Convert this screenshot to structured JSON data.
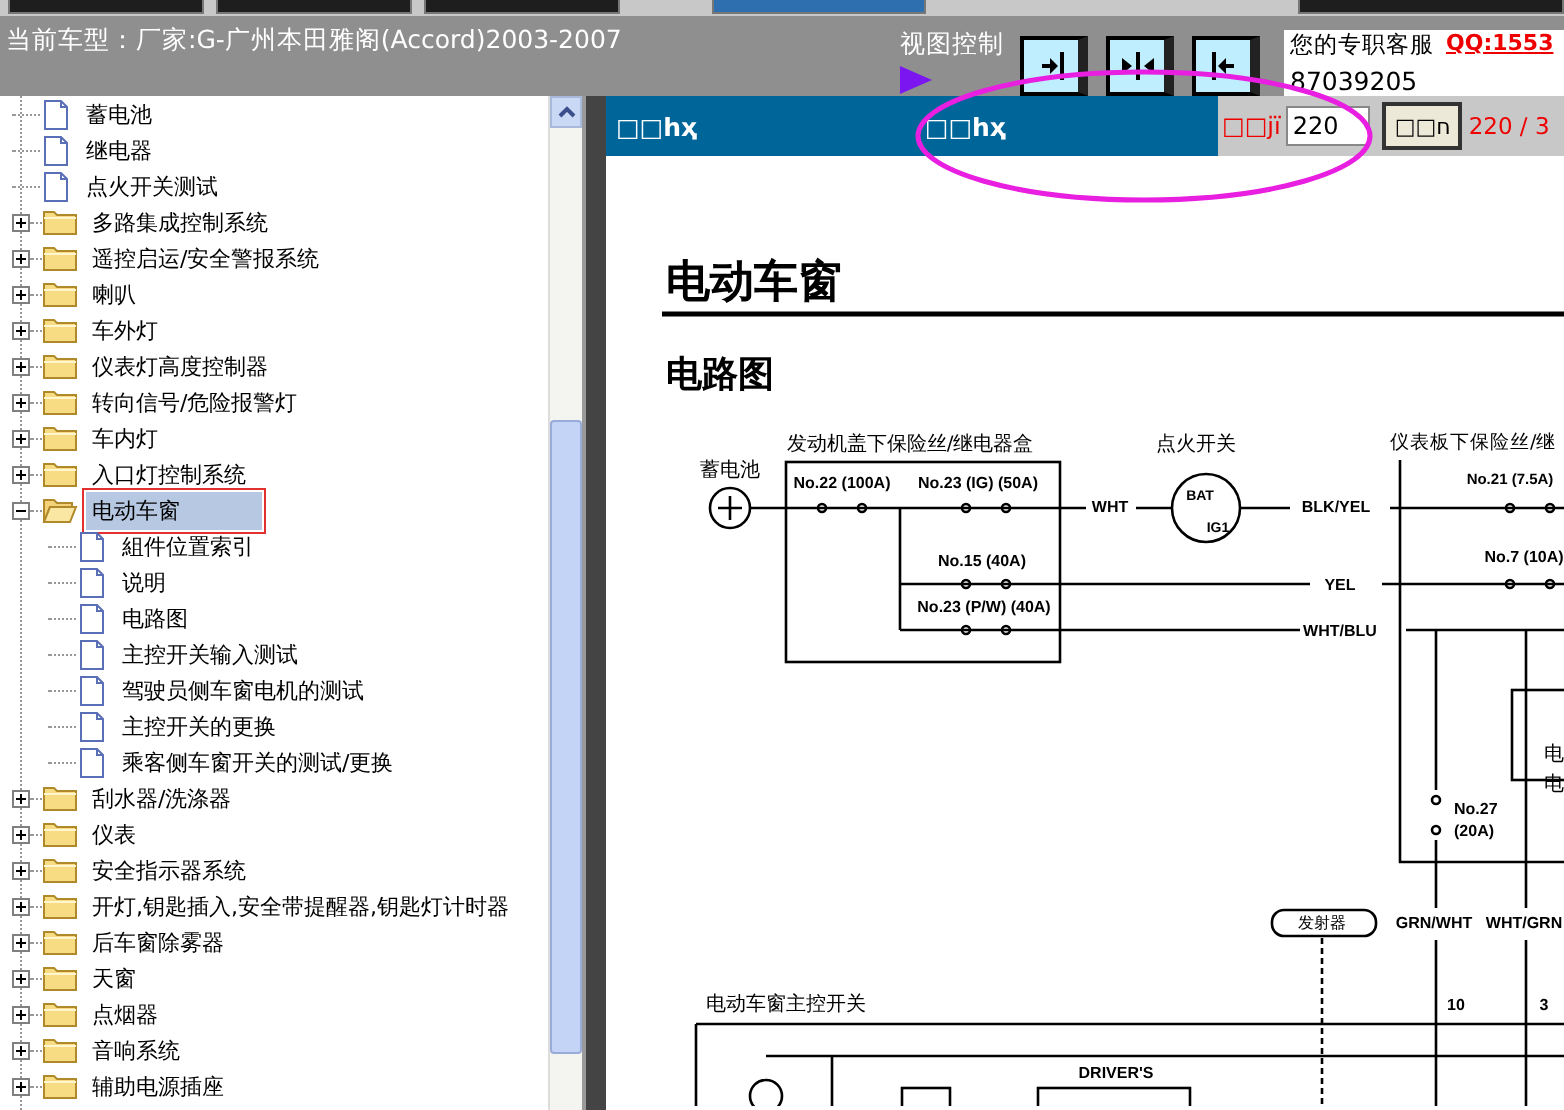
{
  "top_bar": {
    "car_model": "当前车型：厂家:G-广州本田雅阁(Accord)2003-2007",
    "view_control_label": "视图控制",
    "service_label": "您的专职客服",
    "qq_link": "QQ:1553",
    "phone": "87039205"
  },
  "tree": {
    "items": [
      {
        "label": "蓄电池",
        "kind": "doc",
        "selected": false
      },
      {
        "label": "继电器",
        "kind": "doc",
        "selected": false
      },
      {
        "label": "点火开关测试",
        "kind": "doc",
        "selected": false
      },
      {
        "label": "多路集成控制系统",
        "kind": "folder",
        "expanded": false,
        "selected": false
      },
      {
        "label": "遥控启运/安全警报系统",
        "kind": "folder",
        "expanded": false,
        "selected": false
      },
      {
        "label": "喇叭",
        "kind": "folder",
        "expanded": false,
        "selected": false
      },
      {
        "label": "车外灯",
        "kind": "folder",
        "expanded": false,
        "selected": false
      },
      {
        "label": "仪表灯高度控制器",
        "kind": "folder",
        "expanded": false,
        "selected": false
      },
      {
        "label": "转向信号/危险报警灯",
        "kind": "folder",
        "expanded": false,
        "selected": false
      },
      {
        "label": "车内灯",
        "kind": "folder",
        "expanded": false,
        "selected": false
      },
      {
        "label": "入口灯控制系统",
        "kind": "folder",
        "expanded": false,
        "selected": false
      },
      {
        "label": "电动车窗",
        "kind": "folder",
        "expanded": true,
        "selected": true,
        "children": [
          {
            "label": "組件位置索引",
            "kind": "doc",
            "selected": false
          },
          {
            "label": "说明",
            "kind": "doc",
            "selected": false
          },
          {
            "label": "电路图",
            "kind": "doc",
            "selected": false
          },
          {
            "label": "主控开关输入测试",
            "kind": "doc",
            "selected": false
          },
          {
            "label": "驾驶员侧车窗电机的测试",
            "kind": "doc",
            "selected": false
          },
          {
            "label": "主控开关的更换",
            "kind": "doc",
            "selected": false
          },
          {
            "label": "乘客侧车窗开关的测试/更换",
            "kind": "doc",
            "selected": false
          }
        ]
      },
      {
        "label": "刮水器/洗涤器",
        "kind": "folder",
        "expanded": false,
        "selected": false
      },
      {
        "label": "仪表",
        "kind": "folder",
        "expanded": false,
        "selected": false
      },
      {
        "label": "安全指示器系统",
        "kind": "folder",
        "expanded": false,
        "selected": false
      },
      {
        "label": "开灯,钥匙插入,安全带提醒器,钥匙灯计时器",
        "kind": "folder",
        "expanded": false,
        "selected": false
      },
      {
        "label": "后车窗除雾器",
        "kind": "folder",
        "expanded": false,
        "selected": false
      },
      {
        "label": "天窗",
        "kind": "folder",
        "expanded": false,
        "selected": false
      },
      {
        "label": "点烟器",
        "kind": "folder",
        "expanded": false,
        "selected": false
      },
      {
        "label": "音响系统",
        "kind": "folder",
        "expanded": false,
        "selected": false
      },
      {
        "label": "辅助电源插座",
        "kind": "folder",
        "expanded": false,
        "selected": false
      }
    ]
  },
  "viewer": {
    "header_labels": [
      "□□hҳ",
      "□□hҳ"
    ],
    "page_label": "□□jï",
    "page_input": "220",
    "go_button": "□□ח",
    "page_count": "220 / 3"
  },
  "document": {
    "title": "电动车窗",
    "subtitle": "电路图",
    "diagram_labels": [
      "蓄电池",
      "发动机盖下保险丝/继电器盒",
      "点火开关",
      "仪表板下保险丝/继",
      "No.22 (100A)",
      "No.23 (IG) (50A)",
      "WHT",
      "BAT",
      "IG1",
      "BLK/YEL",
      "No.21 (7.5A)",
      "No.15 (40A)",
      "No.7 (10A)",
      "YEL",
      "No.23 (P/W) (40A)",
      "WHT/BLU",
      "电",
      "电",
      "No.27",
      "(20A)",
      "发射器",
      "GRN/WHT",
      "WHT/GRN",
      "电动车窗主控开关",
      "10",
      "3",
      "DRIVER'S"
    ]
  }
}
